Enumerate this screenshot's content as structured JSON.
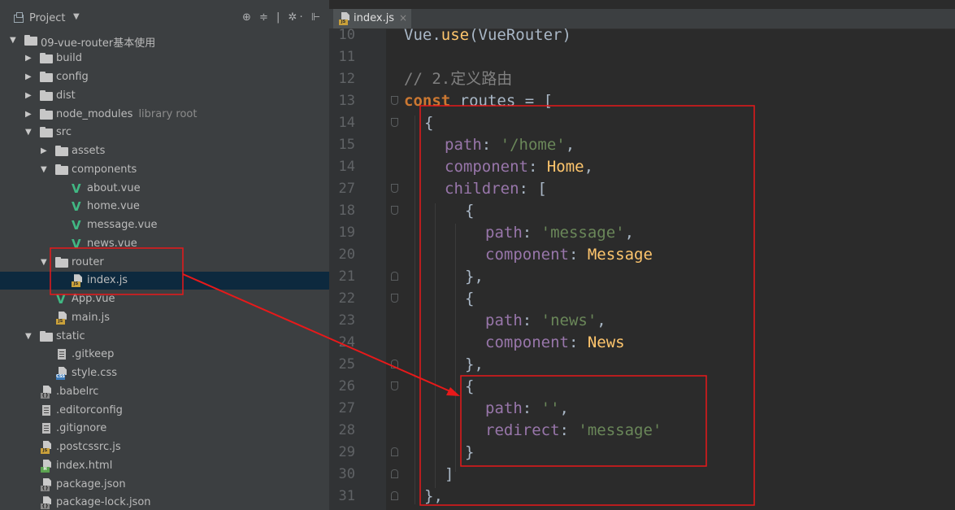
{
  "project": {
    "title": "Project",
    "caret": "▼",
    "tools": "⊕ ≑ | ✲· ⊩"
  },
  "tree": [
    {
      "label": "09-vue-router基本使用",
      "indent": 0,
      "type": "folder",
      "open": true
    },
    {
      "label": "build",
      "indent": 1,
      "type": "folder",
      "open": false
    },
    {
      "label": "config",
      "indent": 1,
      "type": "folder",
      "open": false
    },
    {
      "label": "dist",
      "indent": 1,
      "type": "folder",
      "open": false
    },
    {
      "label": "node_modules",
      "hint": "library root",
      "indent": 1,
      "type": "folder",
      "open": false
    },
    {
      "label": "src",
      "indent": 1,
      "type": "folder",
      "open": true
    },
    {
      "label": "assets",
      "indent": 2,
      "type": "folder",
      "open": false
    },
    {
      "label": "components",
      "indent": 2,
      "type": "folder",
      "open": true
    },
    {
      "label": "about.vue",
      "indent": 3,
      "type": "vue"
    },
    {
      "label": "home.vue",
      "indent": 3,
      "type": "vue"
    },
    {
      "label": "message.vue",
      "indent": 3,
      "type": "vue"
    },
    {
      "label": "news.vue",
      "indent": 3,
      "type": "vue"
    },
    {
      "label": "router",
      "indent": 2,
      "type": "folder",
      "open": true
    },
    {
      "label": "index.js",
      "indent": 3,
      "type": "js",
      "selected": true
    },
    {
      "label": "App.vue",
      "indent": 2,
      "type": "vue"
    },
    {
      "label": "main.js",
      "indent": 2,
      "type": "js"
    },
    {
      "label": "static",
      "indent": 1,
      "type": "folder",
      "open": true
    },
    {
      "label": ".gitkeep",
      "indent": 2,
      "type": "doc"
    },
    {
      "label": "style.css",
      "indent": 2,
      "type": "css"
    },
    {
      "label": ".babelrc",
      "indent": 1,
      "type": "json"
    },
    {
      "label": ".editorconfig",
      "indent": 1,
      "type": "doc"
    },
    {
      "label": ".gitignore",
      "indent": 1,
      "type": "doc"
    },
    {
      "label": ".postcssrc.js",
      "indent": 1,
      "type": "js"
    },
    {
      "label": "index.html",
      "indent": 1,
      "type": "html"
    },
    {
      "label": "package.json",
      "indent": 1,
      "type": "json"
    },
    {
      "label": "package-lock.json",
      "indent": 1,
      "type": "json"
    }
  ],
  "editor": {
    "tab": {
      "name": "index.js",
      "close": "×"
    },
    "lines": [
      {
        "n": "10",
        "indent": 0,
        "tokens": [
          [
            "Vue.",
            ""
          ],
          [
            "use",
            "cls"
          ],
          [
            "(VueRouter)",
            ""
          ]
        ]
      },
      {
        "n": "11",
        "indent": 0,
        "tokens": []
      },
      {
        "n": "12",
        "indent": 0,
        "tokens": [
          [
            "// 2.定义路由",
            "cmt"
          ]
        ]
      },
      {
        "n": "13",
        "indent": 0,
        "fold": "down",
        "tokens": [
          [
            "const",
            "kw"
          ],
          [
            " routes = [",
            ""
          ]
        ]
      },
      {
        "n": "14",
        "indent": 1,
        "fold": "down",
        "tokens": [
          [
            "{",
            ""
          ]
        ]
      },
      {
        "n": "15",
        "indent": 2,
        "tokens": [
          [
            "path",
            "prop"
          ],
          [
            ": ",
            ""
          ],
          [
            "'/home'",
            "str"
          ],
          [
            ",",
            ""
          ]
        ]
      },
      {
        "n": "14",
        "indent": 2,
        "tokens": [
          [
            "component",
            "prop"
          ],
          [
            ": ",
            ""
          ],
          [
            "Home",
            "cls"
          ],
          [
            ",",
            ""
          ]
        ]
      },
      {
        "n": "27",
        "indent": 2,
        "fold": "down",
        "tokens": [
          [
            "children",
            "prop"
          ],
          [
            ": [",
            ""
          ]
        ]
      },
      {
        "n": "18",
        "indent": 3,
        "fold": "down",
        "tokens": [
          [
            "{",
            ""
          ]
        ]
      },
      {
        "n": "19",
        "indent": 4,
        "tokens": [
          [
            "path",
            "prop"
          ],
          [
            ": ",
            ""
          ],
          [
            "'message'",
            "str"
          ],
          [
            ",",
            ""
          ]
        ]
      },
      {
        "n": "20",
        "indent": 4,
        "tokens": [
          [
            "component",
            "prop"
          ],
          [
            ": ",
            ""
          ],
          [
            "Message",
            "cls"
          ]
        ]
      },
      {
        "n": "21",
        "indent": 3,
        "fold": "up",
        "tokens": [
          [
            "},",
            ""
          ]
        ]
      },
      {
        "n": "22",
        "indent": 3,
        "fold": "down",
        "tokens": [
          [
            "{",
            ""
          ]
        ]
      },
      {
        "n": "23",
        "indent": 4,
        "tokens": [
          [
            "path",
            "prop"
          ],
          [
            ": ",
            ""
          ],
          [
            "'news'",
            "str"
          ],
          [
            ",",
            ""
          ]
        ]
      },
      {
        "n": "24",
        "indent": 4,
        "tokens": [
          [
            "component",
            "prop"
          ],
          [
            ": ",
            ""
          ],
          [
            "News",
            "cls"
          ]
        ]
      },
      {
        "n": "25",
        "indent": 3,
        "fold": "up",
        "tokens": [
          [
            "},",
            ""
          ]
        ]
      },
      {
        "n": "26",
        "indent": 3,
        "fold": "down",
        "tokens": [
          [
            "{",
            ""
          ]
        ]
      },
      {
        "n": "27",
        "indent": 4,
        "tokens": [
          [
            "path",
            "prop"
          ],
          [
            ": ",
            ""
          ],
          [
            "''",
            "str"
          ],
          [
            ",",
            ""
          ]
        ]
      },
      {
        "n": "28",
        "indent": 4,
        "tokens": [
          [
            "redirect",
            "prop"
          ],
          [
            ": ",
            ""
          ],
          [
            "'message'",
            "str"
          ]
        ]
      },
      {
        "n": "29",
        "indent": 3,
        "fold": "up",
        "tokens": [
          [
            "}",
            ""
          ]
        ]
      },
      {
        "n": "30",
        "indent": 2,
        "fold": "up",
        "tokens": [
          [
            "]",
            ""
          ]
        ]
      },
      {
        "n": "31",
        "indent": 1,
        "fold": "up",
        "tokens": [
          [
            "},",
            ""
          ]
        ]
      }
    ]
  },
  "annotation_color": "#e8191a"
}
